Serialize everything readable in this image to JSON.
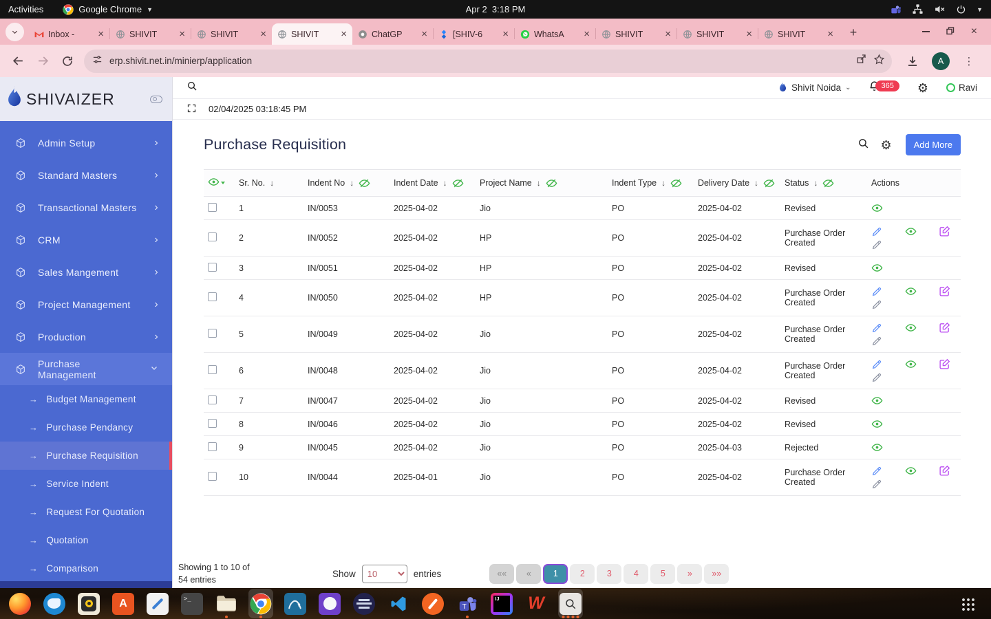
{
  "system_bar": {
    "activities": "Activities",
    "app_name": "Google Chrome",
    "clock": "Apr 2  3:18 PM",
    "tray_icons": [
      "teams-icon",
      "network-icon",
      "volume-muted-icon",
      "power-icon",
      "chevron-down-icon"
    ]
  },
  "browser": {
    "tabs": [
      {
        "label": "Inbox -",
        "icon": "gmail-icon",
        "active": false
      },
      {
        "label": "SHIVIT",
        "icon": "globe-icon",
        "active": false
      },
      {
        "label": "SHIVIT",
        "icon": "globe-icon",
        "active": false
      },
      {
        "label": "SHIVIT",
        "icon": "globe-icon",
        "active": true
      },
      {
        "label": "ChatGP",
        "icon": "chatgpt-icon",
        "active": false
      },
      {
        "label": "[SHIV-6",
        "icon": "jira-icon",
        "active": false
      },
      {
        "label": "WhatsA",
        "icon": "whatsapp-icon",
        "active": false
      },
      {
        "label": "SHIVIT",
        "icon": "globe-icon",
        "active": false
      },
      {
        "label": "SHIVIT",
        "icon": "globe-icon",
        "active": false
      },
      {
        "label": "SHIVIT",
        "icon": "globe-icon",
        "active": false
      }
    ],
    "url": "erp.shivit.net.in/minierp/application",
    "avatar_letter": "A"
  },
  "sidebar": {
    "brand": "SHIVAIZER",
    "items": [
      {
        "label": "Admin Setup",
        "expanded": false
      },
      {
        "label": "Standard Masters",
        "expanded": false
      },
      {
        "label": "Transactional Masters",
        "expanded": false
      },
      {
        "label": "CRM",
        "expanded": false
      },
      {
        "label": "Sales Mangement",
        "expanded": false
      },
      {
        "label": "Project Management",
        "expanded": false
      },
      {
        "label": "Production",
        "expanded": false
      },
      {
        "label": "Purchase Management",
        "expanded": true
      }
    ],
    "submenu": [
      {
        "label": "Budget Management",
        "active": false
      },
      {
        "label": "Purchase Pendancy",
        "active": false
      },
      {
        "label": "Purchase Requisition",
        "active": true
      },
      {
        "label": "Service Indent",
        "active": false
      },
      {
        "label": "Request For Quotation",
        "active": false
      },
      {
        "label": "Quotation",
        "active": false
      },
      {
        "label": "Comparison",
        "active": false
      }
    ]
  },
  "app_header": {
    "datetime": "02/04/2025 03:18:45 PM",
    "company": "Shivit Noida",
    "notification_count": "365",
    "user": "Ravi"
  },
  "page": {
    "title": "Purchase Requisition",
    "add_more_label": "Add More"
  },
  "table": {
    "columns": [
      {
        "label": "Sr. No.",
        "sort": true,
        "hide": false
      },
      {
        "label": "Indent No",
        "sort": true,
        "hide": true
      },
      {
        "label": "Indent Date",
        "sort": true,
        "hide": true
      },
      {
        "label": "Project Name",
        "sort": true,
        "hide": true
      },
      {
        "label": "Indent Type",
        "sort": true,
        "hide": true
      },
      {
        "label": "Delivery Date",
        "sort": true,
        "hide": true
      },
      {
        "label": "Status",
        "sort": true,
        "hide": true
      },
      {
        "label": "Actions",
        "sort": false,
        "hide": false
      }
    ],
    "rows": [
      {
        "sr": "1",
        "indent_no": "IN/0053",
        "indent_date": "2025-04-02",
        "project": "Jio",
        "type": "PO",
        "delivery": "2025-04-02",
        "status": "Revised",
        "actions": "view"
      },
      {
        "sr": "2",
        "indent_no": "IN/0052",
        "indent_date": "2025-04-02",
        "project": "HP",
        "type": "PO",
        "delivery": "2025-04-02",
        "status": "Purchase Order Created",
        "actions": "full"
      },
      {
        "sr": "3",
        "indent_no": "IN/0051",
        "indent_date": "2025-04-02",
        "project": "HP",
        "type": "PO",
        "delivery": "2025-04-02",
        "status": "Revised",
        "actions": "view"
      },
      {
        "sr": "4",
        "indent_no": "IN/0050",
        "indent_date": "2025-04-02",
        "project": "HP",
        "type": "PO",
        "delivery": "2025-04-02",
        "status": "Purchase Order Created",
        "actions": "full"
      },
      {
        "sr": "5",
        "indent_no": "IN/0049",
        "indent_date": "2025-04-02",
        "project": "Jio",
        "type": "PO",
        "delivery": "2025-04-02",
        "status": "Purchase Order Created",
        "actions": "full"
      },
      {
        "sr": "6",
        "indent_no": "IN/0048",
        "indent_date": "2025-04-02",
        "project": "Jio",
        "type": "PO",
        "delivery": "2025-04-02",
        "status": "Purchase Order Created",
        "actions": "full"
      },
      {
        "sr": "7",
        "indent_no": "IN/0047",
        "indent_date": "2025-04-02",
        "project": "Jio",
        "type": "PO",
        "delivery": "2025-04-02",
        "status": "Revised",
        "actions": "view"
      },
      {
        "sr": "8",
        "indent_no": "IN/0046",
        "indent_date": "2025-04-02",
        "project": "Jio",
        "type": "PO",
        "delivery": "2025-04-02",
        "status": "Revised",
        "actions": "view"
      },
      {
        "sr": "9",
        "indent_no": "IN/0045",
        "indent_date": "2025-04-02",
        "project": "Jio",
        "type": "PO",
        "delivery": "2025-04-03",
        "status": "Rejected",
        "actions": "view"
      },
      {
        "sr": "10",
        "indent_no": "IN/0044",
        "indent_date": "2025-04-01",
        "project": "Jio",
        "type": "PO",
        "delivery": "2025-04-02",
        "status": "Purchase Order Created",
        "actions": "full"
      }
    ]
  },
  "pagination": {
    "summary_line1": "Showing 1 to 10 of",
    "summary_line2": "54 entries",
    "show_label": "Show",
    "entries_label": "entries",
    "page_size": "10",
    "buttons": [
      {
        "label": "««",
        "state": "disabled"
      },
      {
        "label": "«",
        "state": "disabled"
      },
      {
        "label": "1",
        "state": "active"
      },
      {
        "label": "2",
        "state": "normal"
      },
      {
        "label": "3",
        "state": "normal"
      },
      {
        "label": "4",
        "state": "normal"
      },
      {
        "label": "5",
        "state": "normal"
      },
      {
        "label": "»",
        "state": "normal"
      },
      {
        "label": "»»",
        "state": "normal"
      }
    ]
  },
  "dock": {
    "items": [
      {
        "name": "firefox",
        "dots": 0,
        "active": false
      },
      {
        "name": "thunderbird",
        "dots": 0,
        "active": false
      },
      {
        "name": "rhythmbox",
        "dots": 0,
        "active": false
      },
      {
        "name": "ubuntu-software",
        "dots": 0,
        "active": false
      },
      {
        "name": "text-editor",
        "dots": 0,
        "active": false
      },
      {
        "name": "terminal",
        "dots": 0,
        "active": false
      },
      {
        "name": "files",
        "dots": 1,
        "active": false
      },
      {
        "name": "chrome",
        "dots": 1,
        "active": true
      },
      {
        "name": "mysql-workbench",
        "dots": 0,
        "active": false
      },
      {
        "name": "github-desktop",
        "dots": 0,
        "active": false
      },
      {
        "name": "eclipse",
        "dots": 0,
        "active": false
      },
      {
        "name": "vscode",
        "dots": 0,
        "active": false
      },
      {
        "name": "pencil-app",
        "dots": 0,
        "active": false
      },
      {
        "name": "teams",
        "dots": 1,
        "active": false
      },
      {
        "name": "intellij-idea",
        "dots": 0,
        "active": false
      },
      {
        "name": "wps-office",
        "dots": 0,
        "active": false
      },
      {
        "name": "screenshot-tool",
        "dots": 4,
        "active": true
      }
    ]
  },
  "colors": {
    "sidebar_blue": "#4b69d1",
    "sidebar_active_bar": "#e84d60",
    "accent_blue": "#4c79ee",
    "action_green": "#43b64c",
    "action_pencil_blue": "#5a8cf8",
    "action_pencil_grey": "#8a90a0",
    "action_edit_purple": "#bb4df2",
    "badge_red": "#ef3b52",
    "pagination_active_bg": "#3e90a8",
    "pagination_active_border": "#8a4bd8",
    "pagination_number_red": "#e05b6b",
    "chrome_theme_pink": "#f3bcc6"
  }
}
